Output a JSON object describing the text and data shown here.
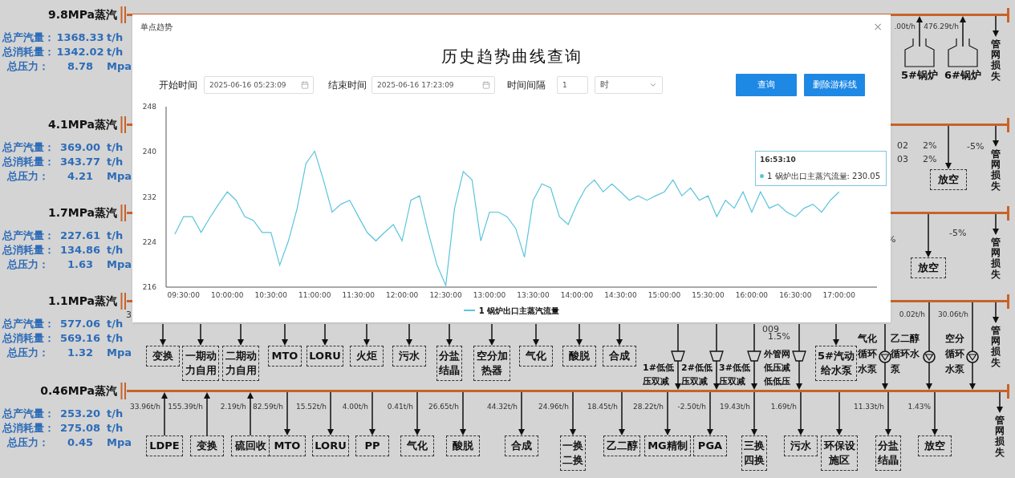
{
  "pipes": [
    {
      "name": "9.8MPa蒸汽",
      "stats": [
        {
          "label": "总产汽量：",
          "value": "1368.33",
          "unit": "t/h"
        },
        {
          "label": "总消耗量：",
          "value": "1342.02",
          "unit": "t/h"
        },
        {
          "label": "总压力：",
          "value": "8.78",
          "unit": "Mpa"
        }
      ],
      "branches": [
        {
          "kind": "boiler",
          "label": "5#锅炉",
          "flow": ".00t/h"
        },
        {
          "kind": "boiler",
          "label": "6#锅炉",
          "flow": "476.29t/h"
        },
        {
          "kind": "loss",
          "label": "管网损失"
        }
      ]
    },
    {
      "name": "4.1MPa蒸汽",
      "stats": [
        {
          "label": "总产汽量：",
          "value": "369.00",
          "unit": "t/h"
        },
        {
          "label": "总消耗量：",
          "value": "343.77",
          "unit": "t/h"
        },
        {
          "label": "总压力：",
          "value": "4.21",
          "unit": "Mpa"
        }
      ],
      "branches": [
        {
          "kind": "note",
          "label": "02"
        },
        {
          "kind": "note",
          "label": "2%"
        },
        {
          "kind": "note",
          "label": "03"
        },
        {
          "kind": "note",
          "label": "2%"
        },
        {
          "kind": "box",
          "label": "放空"
        },
        {
          "kind": "note",
          "label": "-5%"
        },
        {
          "kind": "loss",
          "label": "管网损失"
        }
      ]
    },
    {
      "name": "1.7MPa蒸汽",
      "stats": [
        {
          "label": "总产汽量：",
          "value": "227.61",
          "unit": "t/h"
        },
        {
          "label": "总消耗量：",
          "value": "134.86",
          "unit": "t/h"
        },
        {
          "label": "总压力：",
          "value": "1.63",
          "unit": "Mpa"
        }
      ],
      "branches": [
        {
          "kind": "note",
          "label": "%"
        },
        {
          "kind": "box",
          "label": "放空"
        },
        {
          "kind": "note",
          "label": "-5%"
        },
        {
          "kind": "loss",
          "label": "管网损失"
        }
      ]
    },
    {
      "name": "1.1MPa蒸汽",
      "stats": [
        {
          "label": "总产汽量：",
          "value": "577.06",
          "unit": "t/h"
        },
        {
          "label": "总消耗量：",
          "value": "569.16",
          "unit": "t/h"
        },
        {
          "label": "总压力：",
          "value": "1.32",
          "unit": "Mpa"
        }
      ],
      "branches": [
        {
          "kind": "note",
          "label": "3"
        },
        {
          "kind": "box",
          "label": "变换"
        },
        {
          "kind": "box",
          "label": "一期动力自用"
        },
        {
          "kind": "box",
          "label": "二期动力自用"
        },
        {
          "kind": "box",
          "label": "MTO"
        },
        {
          "kind": "box",
          "label": "LORU"
        },
        {
          "kind": "box",
          "label": "火炬"
        },
        {
          "kind": "box",
          "label": "污水"
        },
        {
          "kind": "box",
          "label": "分盐结晶"
        },
        {
          "kind": "box",
          "label": "空分加热器"
        },
        {
          "kind": "box",
          "label": "气化"
        },
        {
          "kind": "box",
          "label": "酸脱"
        },
        {
          "kind": "box",
          "label": "合成"
        },
        {
          "kind": "reducer",
          "label": "1#低低压双减"
        },
        {
          "kind": "reducer",
          "label": "2#低低压双减"
        },
        {
          "kind": "reducer",
          "label": "3#低低压双减"
        },
        {
          "kind": "note",
          "label": "009"
        },
        {
          "kind": "note",
          "label": "1.5%"
        },
        {
          "kind": "reducer",
          "label": "外管网低压减低低压"
        },
        {
          "kind": "box",
          "label": "5#汽动给水泵"
        },
        {
          "kind": "pump",
          "label": "气化循环水泵"
        },
        {
          "kind": "pump",
          "label": "乙二醇循环水泵",
          "flow": "0.02t/h"
        },
        {
          "kind": "pump",
          "label": "空分循环水泵",
          "flow": "30.06t/h"
        },
        {
          "kind": "loss",
          "label": "管网损失"
        }
      ]
    },
    {
      "name": "0.46MPa蒸汽",
      "stats": [
        {
          "label": "总产汽量：",
          "value": "253.20",
          "unit": "t/h"
        },
        {
          "label": "总消耗量：",
          "value": "275.08",
          "unit": "t/h"
        },
        {
          "label": "总压力：",
          "value": "0.45",
          "unit": "Mpa"
        }
      ],
      "branches": [
        {
          "kind": "source",
          "label": "LDPE",
          "flow": "33.96t/h"
        },
        {
          "kind": "source",
          "label": "变换",
          "flow": "155.39t/h"
        },
        {
          "kind": "source",
          "label": "硫回收",
          "flow": "2.19t/h"
        },
        {
          "kind": "box",
          "label": "MTO",
          "flow": "82.59t/h"
        },
        {
          "kind": "box",
          "label": "LORU",
          "flow": "15.52t/h"
        },
        {
          "kind": "box",
          "label": "PP",
          "flow": "4.00t/h"
        },
        {
          "kind": "box",
          "label": "气化",
          "flow": "0.41t/h"
        },
        {
          "kind": "box",
          "label": "酸脱",
          "flow": "26.65t/h"
        },
        {
          "kind": "box",
          "label": "合成",
          "flow": "44.32t/h"
        },
        {
          "kind": "box",
          "label": "一换二换",
          "flow": "24.96t/h"
        },
        {
          "kind": "box",
          "label": "乙二醇",
          "flow": "18.45t/h"
        },
        {
          "kind": "box",
          "label": "MG精制",
          "flow": "28.22t/h"
        },
        {
          "kind": "box",
          "label": "PGA",
          "flow": "-2.50t/h"
        },
        {
          "kind": "box",
          "label": "三换四换",
          "flow": "19.43t/h"
        },
        {
          "kind": "box",
          "label": "污水",
          "flow": "1.69t/h"
        },
        {
          "kind": "box",
          "label": "环保设施区"
        },
        {
          "kind": "box",
          "label": "分盐结晶",
          "flow": "11.33t/h"
        },
        {
          "kind": "box",
          "label": "放空",
          "flow": "1.43%"
        },
        {
          "kind": "loss",
          "label": "管网损失"
        }
      ]
    }
  ],
  "dialog": {
    "title": "单点趋势",
    "close": "×",
    "heading": "历史趋势曲线查询",
    "start_label": "开始时间",
    "start_value": "2025-06-16 05:23:09",
    "end_label": "结束时间",
    "end_value": "2025-06-16 17:23:09",
    "interval_label": "时间间隔",
    "interval_value": "1",
    "interval_unit": "时",
    "buttons": [
      "查询",
      "删除游标线"
    ],
    "tooltip": {
      "time": "16:53:10",
      "text": "1 锅炉出口主蒸汽流量: 230.05"
    },
    "chart_data": {
      "type": "line",
      "categories": [
        null,
        "09:30:00",
        null,
        null,
        null,
        null,
        "10:00:00",
        null,
        null,
        null,
        null,
        "10:30:00",
        null,
        null,
        null,
        null,
        "11:00:00",
        null,
        null,
        null,
        null,
        "11:30:00",
        null,
        null,
        null,
        null,
        "12:00:00",
        null,
        null,
        null,
        null,
        "12:30:00",
        null,
        null,
        null,
        null,
        "13:00:00",
        null,
        null,
        null,
        null,
        "13:30:00",
        null,
        null,
        null,
        null,
        "14:00:00",
        null,
        null,
        null,
        null,
        "14:30:00",
        null,
        null,
        null,
        null,
        "15:00:00",
        null,
        null,
        null,
        null,
        "15:30:00",
        null,
        null,
        null,
        null,
        "16:00:00",
        null,
        null,
        null,
        null,
        "16:30:00",
        null,
        null,
        null,
        null,
        "17:00:00"
      ],
      "series": [
        {
          "name": "1 锅炉出口主蒸汽流量",
          "color": "#5bc4dc",
          "values": [
            225.4,
            228.5,
            228.5,
            225.7,
            228.3,
            230.7,
            232.9,
            231.4,
            228.5,
            227.8,
            225.7,
            225.7,
            219.9,
            224.2,
            230,
            237.9,
            240.1,
            235,
            229.3,
            230.7,
            231.4,
            228.5,
            225.7,
            224.2,
            225.7,
            227.1,
            224.2,
            231.4,
            232.2,
            225.7,
            219.9,
            216.3,
            230,
            236.5,
            235,
            224.2,
            229.3,
            229.3,
            228.5,
            226.4,
            221.3,
            231.4,
            234.3,
            233.6,
            228.5,
            227.1,
            230.7,
            233.6,
            235,
            232.9,
            234.3,
            232.9,
            231.4,
            232.2,
            231.4,
            232.2,
            232.9,
            235,
            232.2,
            233.6,
            231.4,
            232.2,
            228.5,
            231.4,
            230,
            232.9,
            229.3,
            232.9,
            230,
            230.7,
            229.3,
            228.5,
            230,
            230.7,
            229.3,
            231.4,
            232.9
          ]
        }
      ],
      "ylim": [
        216,
        248
      ],
      "yticks": [
        216,
        224,
        232,
        240,
        248
      ]
    }
  }
}
